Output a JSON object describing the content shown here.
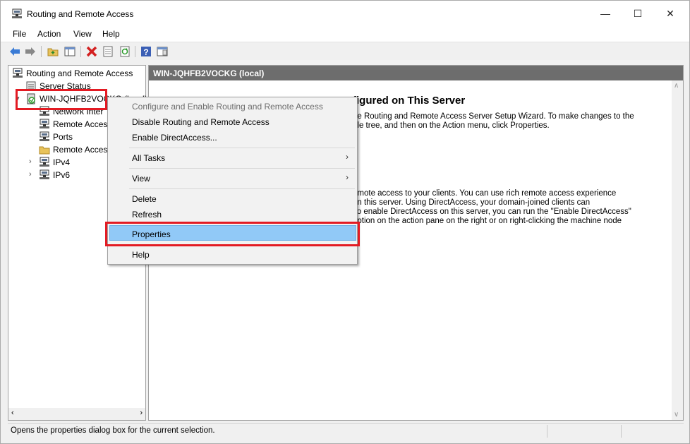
{
  "window": {
    "title": "Routing and Remote Access",
    "controls": {
      "minimize": "—",
      "maximize": "☐",
      "close": "✕"
    }
  },
  "menu": [
    "File",
    "Action",
    "View",
    "Help"
  ],
  "toolbar": [
    "back-icon",
    "forward-icon",
    "up-folder-icon",
    "show-hide-tree-icon",
    "delete-icon",
    "properties-icon",
    "refresh-icon",
    "help-icon",
    "console-icon"
  ],
  "tree": {
    "root": "Routing and Remote Access",
    "server_status": "Server Status",
    "server": "WIN-JQHFB2VOCK",
    "server_suffix": "G (local)",
    "children": [
      "Network Inter",
      "Remote Acces",
      "Ports",
      "Remote Acces",
      "IPv4",
      "IPv6"
    ]
  },
  "right_pane": {
    "header": "WIN-JQHFB2VOCKG (local)",
    "heading": "figured on This Server",
    "para1": [
      "he Routing and Remote Access Server Setup Wizard. To make changes to the",
      "ole tree, and then on the Action menu, click Properties."
    ],
    "para2": [
      "emote access to your clients. You can use rich remote access experience",
      " on this server. Using DirectAccess, your domain-joined clients can",
      "To enable DirectAccess on this server, you can run the \"Enable DirectAccess\"",
      "option on the action pane on the right or on right-clicking the machine node"
    ]
  },
  "context_menu": {
    "configure": "Configure and Enable Routing and Remote Access",
    "disable": "Disable Routing and Remote Access",
    "enable_da": "Enable DirectAccess...",
    "all_tasks": "All Tasks",
    "view": "View",
    "delete": "Delete",
    "refresh": "Refresh",
    "properties": "Properties",
    "help": "Help",
    "submenu_arrow": "›"
  },
  "status": {
    "text": "Opens the properties dialog box for the current selection."
  },
  "colors": {
    "highlight_red": "#e31b23",
    "selection_blue": "#91c9f7",
    "header_gray": "#6d6d6d"
  }
}
